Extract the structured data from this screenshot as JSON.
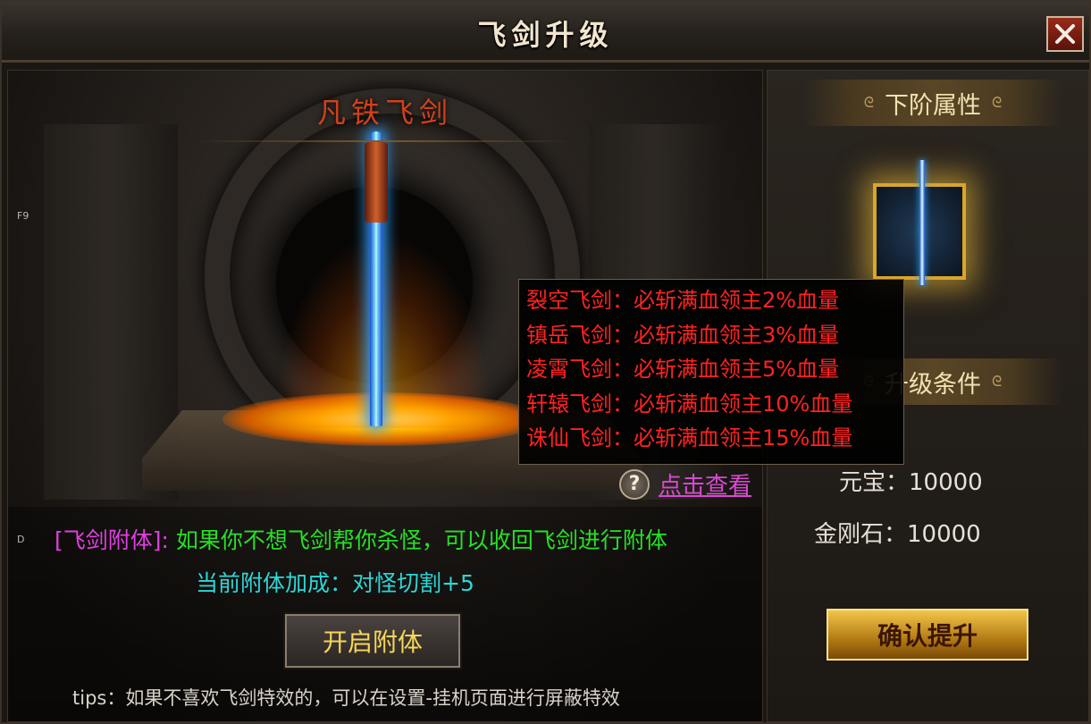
{
  "window": {
    "title": "飞剑升级"
  },
  "left": {
    "sword_name": "凡铁飞剑",
    "hotkey_f9": "F9",
    "hotkey_d": "D",
    "attach_label": "[飞剑附体]:",
    "attach_text": "如果你不想飞剑帮你杀怪，可以收回飞剑进行附体",
    "bonus_label": "当前附体加成：",
    "bonus_value": "对怪切割+5",
    "help_link": "点击查看",
    "attach_button": "开启附体",
    "tips": "tips：如果不喜欢飞剑特效的，可以在设置-挂机页面进行屏蔽特效"
  },
  "tooltip": {
    "lines": [
      "裂空飞剑：必斩满血领主2%血量",
      "镇岳飞剑：必斩满血领主3%血量",
      "凌霄飞剑：必斩满血领主5%血量",
      "轩辕飞剑：必斩满血领主10%血量",
      "诛仙飞剑：必斩满血领主15%血量"
    ]
  },
  "right": {
    "next_attr_title": "下阶属性",
    "upgrade_cond_title": "升级条件",
    "cost_yuanbao": "元宝：10000",
    "cost_diamond": "金刚石：10000",
    "confirm_button": "确认提升"
  },
  "colors": {
    "tooltip_text": "#ff2222",
    "attach_label": "#e040e0",
    "attach_text": "#27e027",
    "bonus": "#2ed6d6",
    "link": "#d54ad0"
  }
}
